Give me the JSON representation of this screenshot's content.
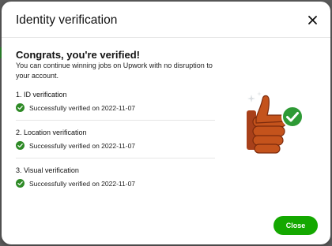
{
  "modal": {
    "title": "Identity verification",
    "heading": "Congrats, you're verified!",
    "subtext": "You can continue winning jobs on Upwork with no disruption to your account."
  },
  "steps": [
    {
      "title": "1. ID verification",
      "status": "Successfully verified on 2022-11-07"
    },
    {
      "title": "2. Location verification",
      "status": "Successfully verified on 2022-11-07"
    },
    {
      "title": "3. Visual verification",
      "status": "Successfully verified on 2022-11-07"
    }
  ],
  "footer": {
    "close_label": "Close"
  },
  "icons": {
    "close": "close-icon",
    "check": "check-circle-icon",
    "illustration": "thumbs-up-check-illustration"
  },
  "colors": {
    "accent": "#14a800",
    "check": "#2e8a26",
    "thumb": "#c4531c"
  }
}
